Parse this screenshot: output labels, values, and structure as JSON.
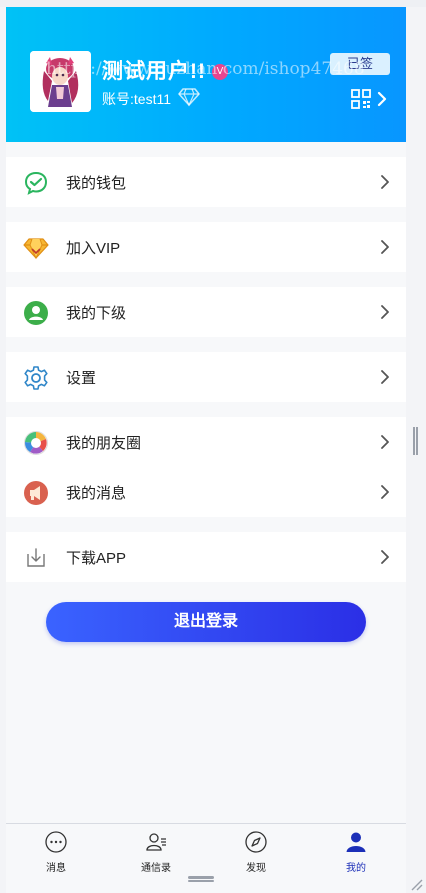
{
  "watermark": "https://www.huzhan.com/ishop47468",
  "header": {
    "username": "测试用户!!",
    "vip_badge": "V",
    "account": "账号:test11",
    "signed_label": "已签",
    "colors": {
      "gradient_start": "#00c2f6",
      "gradient_end": "#0896ff"
    }
  },
  "menu": {
    "wallet": "我的钱包",
    "vip": "加入VIP",
    "subordinates": "我的下级",
    "settings": "设置",
    "moments": "我的朋友圈",
    "messages": "我的消息",
    "download": "下载APP"
  },
  "logout_label": "退出登录",
  "tabs": [
    {
      "label": "消息",
      "icon": "chat-bubble-icon",
      "active": false
    },
    {
      "label": "通信录",
      "icon": "contacts-icon",
      "active": false
    },
    {
      "label": "发现",
      "icon": "compass-icon",
      "active": false
    },
    {
      "label": "我的",
      "icon": "user-icon",
      "active": true
    }
  ]
}
